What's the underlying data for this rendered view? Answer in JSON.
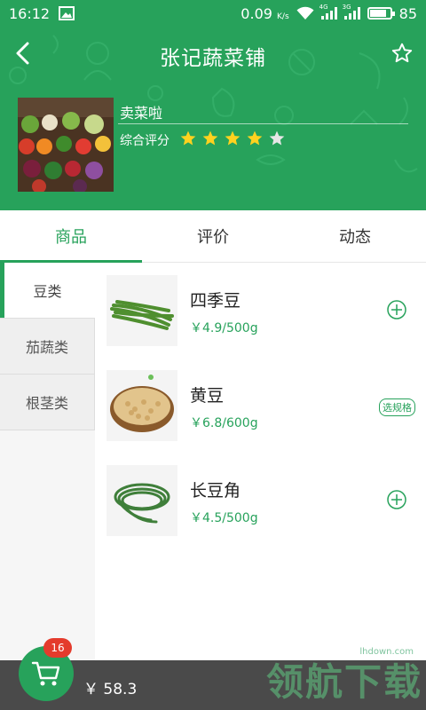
{
  "status_bar": {
    "time": "16:12",
    "speed": "0.09",
    "speed_unit": "K/s",
    "network_1": "4G",
    "network_2": "3G",
    "battery_level": "85"
  },
  "header": {
    "title": "张记蔬菜铺",
    "shop_name": "卖菜啦",
    "rating_label": "综合评分",
    "rating": 4,
    "rating_max": 5,
    "colors": {
      "primary": "#27a25b",
      "star_on": "#ffd21f",
      "star_off": "#e6e6e6"
    },
    "icons": {
      "back": "back-arrow-icon",
      "favorite": "star-outline-icon"
    }
  },
  "tabs": [
    {
      "label": "商品",
      "active": true
    },
    {
      "label": "评价",
      "active": false
    },
    {
      "label": "动态",
      "active": false
    }
  ],
  "categories": [
    {
      "label": "豆类",
      "active": true
    },
    {
      "label": "茄蔬类",
      "active": false
    },
    {
      "label": "根茎类",
      "active": false
    }
  ],
  "products": [
    {
      "name": "四季豆",
      "price": "￥4.9/500g",
      "action": "add",
      "icon": "add-circle-icon"
    },
    {
      "name": "黄豆",
      "price": "￥6.8/600g",
      "action": "spec",
      "action_label": "选规格"
    },
    {
      "name": "长豆角",
      "price": "￥4.5/500g",
      "action": "add",
      "icon": "add-circle-icon"
    }
  ],
  "cart": {
    "count": "16",
    "total": "￥ 58.3",
    "icon": "shopping-cart-icon"
  },
  "watermark": {
    "url": "lhdown.com",
    "text": "领航下载"
  }
}
